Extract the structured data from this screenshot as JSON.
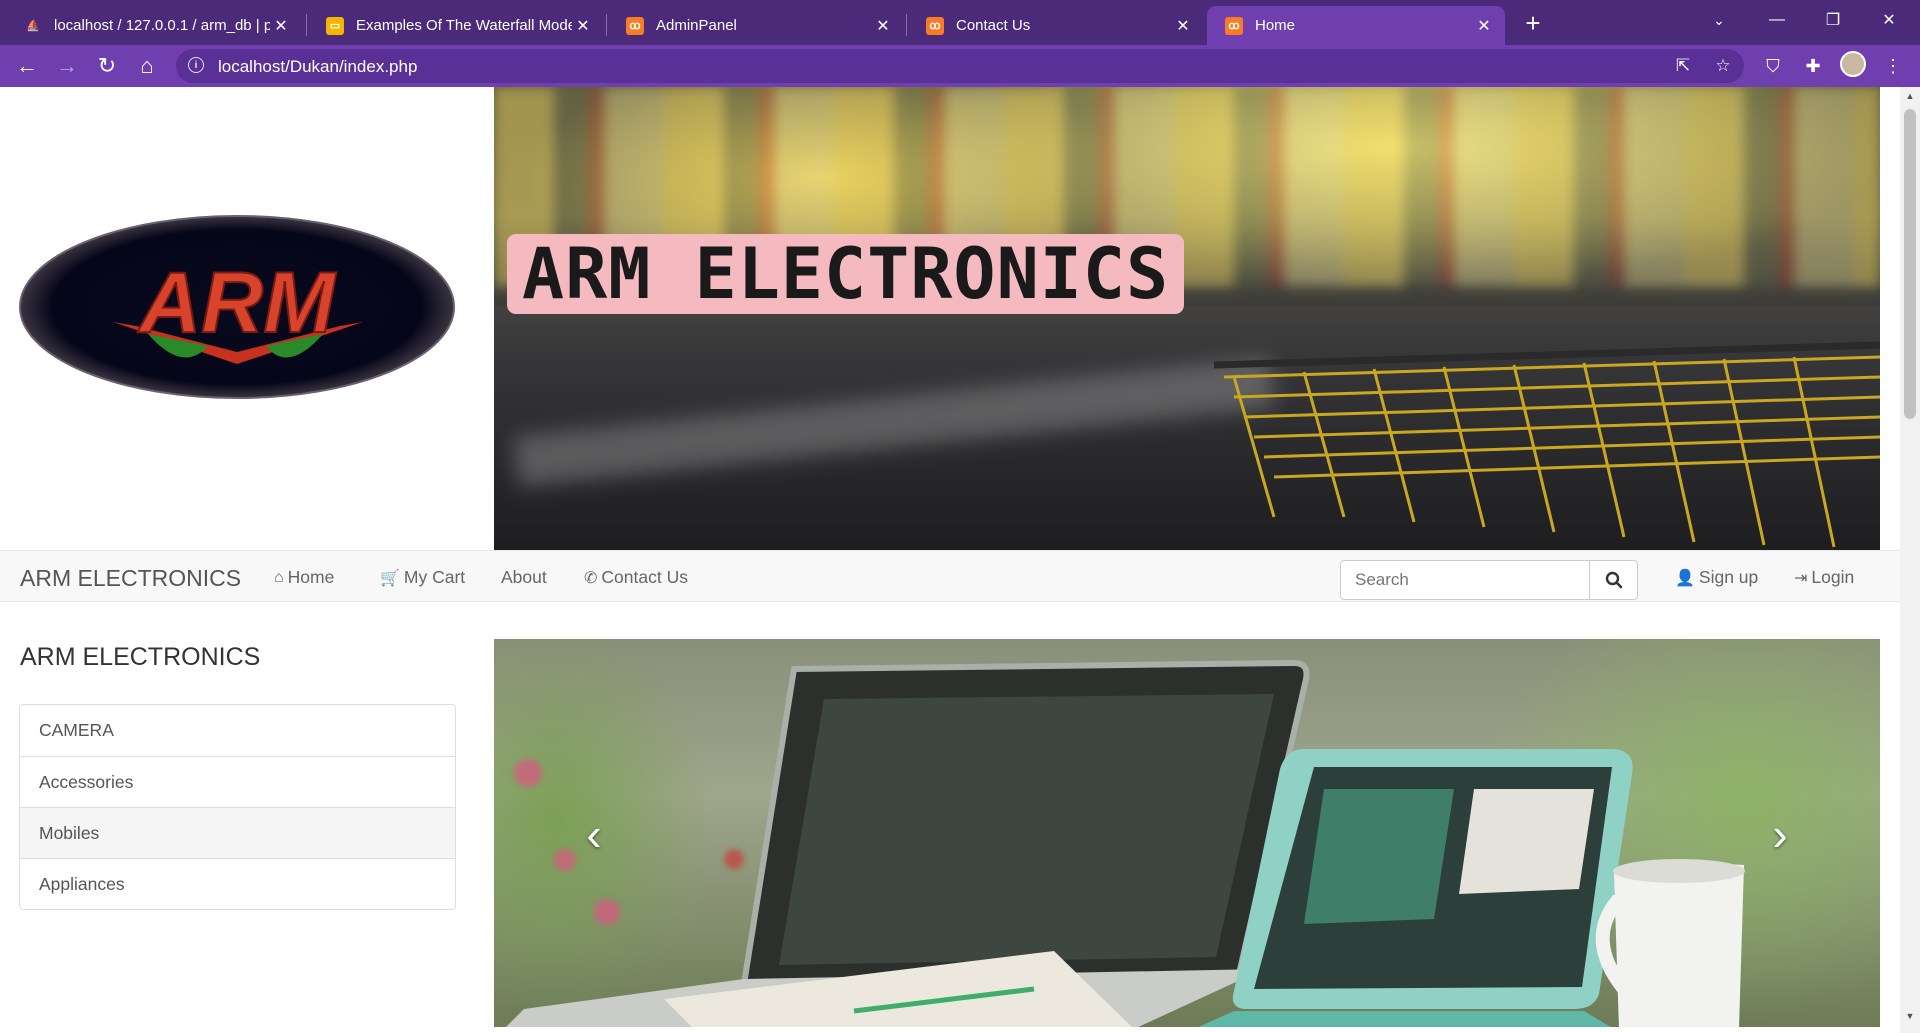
{
  "browser": {
    "tabs": [
      {
        "title": "localhost / 127.0.0.1 / arm_db | phpMyAdmin",
        "favicon": "phpmyadmin-icon",
        "active": false
      },
      {
        "title": "Examples Of The Waterfall Model",
        "favicon": "slides-icon",
        "active": false
      },
      {
        "title": "AdminPanel",
        "favicon": "xampp-icon",
        "active": false
      },
      {
        "title": "Contact Us",
        "favicon": "xampp-icon",
        "active": false
      },
      {
        "title": "Home",
        "favicon": "xampp-icon",
        "active": true
      }
    ],
    "url": "localhost/Dukan/index.php",
    "colors": {
      "tabbar": "#4b2a79",
      "toolbar": "#6f3fb0"
    }
  },
  "site": {
    "logo_text": "ARM",
    "hero_title": "ARM ELECTRONICS",
    "navbar": {
      "brand": "ARM ELECTRONICS",
      "links": [
        {
          "label": "Home",
          "icon": "home-icon"
        },
        {
          "label": "My Cart",
          "icon": "cart-icon"
        },
        {
          "label": "About",
          "icon": ""
        },
        {
          "label": "Contact Us",
          "icon": "phone-icon"
        }
      ],
      "search_placeholder": "Search",
      "signup": "Sign up",
      "login": "Login"
    },
    "sidebar": {
      "title": "ARM ELECTRONICS",
      "categories": [
        "CAMERA",
        "Accessories",
        "Mobiles",
        "Appliances"
      ],
      "highlighted_index": 2
    },
    "carousel": {
      "prev": "‹",
      "next": "›"
    }
  }
}
